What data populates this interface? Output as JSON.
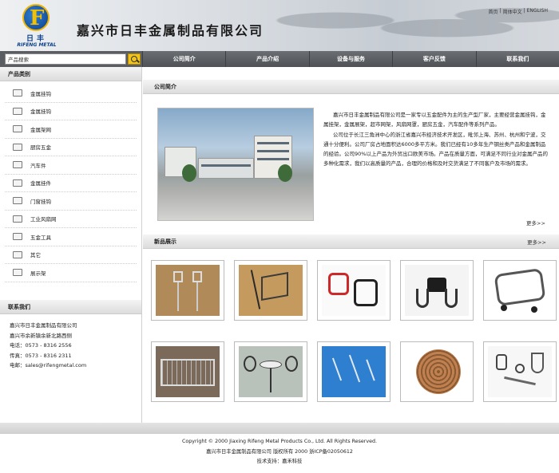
{
  "header": {
    "company_name": "嘉兴市日丰金属制品有限公司",
    "logo_cn": "日丰",
    "logo_en": "RIFENG METAL",
    "logo_letter": "F",
    "top_links": [
      "首页",
      "|",
      "简体中文",
      "|",
      "ENGLISH"
    ]
  },
  "search": {
    "value": "产品搜索"
  },
  "nav": [
    "公司简介",
    "产品介绍",
    "设备与服务",
    "客户反馈",
    "联系我们"
  ],
  "sidebar": {
    "category_title": "产品类别",
    "categories": [
      "金属挂钩",
      "金属挂钩",
      "金属架网",
      "厨房五金",
      "汽车件",
      "金属挂件",
      "门窗挂钩",
      "工业风扇网",
      "五金工具",
      "其它",
      "展示架"
    ],
    "contact_title": "联系我们",
    "contact_lines": [
      "嘉兴市日丰金属制品有限公司",
      "嘉兴市余新镇余新北路西侧",
      "电话：0573 - 8316 2556",
      "传真：0573 - 8316 2311",
      "电邮：sales@rifengmetal.com"
    ]
  },
  "about": {
    "title": "公司简介",
    "paragraphs": [
      "嘉兴市日丰金属制品有限公司是一家专以五金配件为主的生产型厂家，主要经营金属挂钩，金属挂架，金属展架，超市网架，风扇网罩，厨房五金，汽车配件等系列产品。",
      "公司位于长江三角洲中心的浙江省嘉兴市经济技术开发区，毗邻上海、苏州、杭州和宁波，交通十分便利。公司厂房占地面积达6000多平方米。我们已经有10多年生产钢丝类产品和金属制品的经验。公司90%以上产品为外贸出口欧美市场。产品在质量方面，可满足不同行业对金属产品的多种化需求，我们以高质量的产品，合理的价格和及时交货满足了不同客户及市场的需求。"
    ],
    "more": "更多>>"
  },
  "products_section": {
    "title": "新品展示",
    "more": "更多>>"
  },
  "products": [
    {
      "icon": "hook-pair-icon"
    },
    {
      "icon": "wire-rack-icon"
    },
    {
      "icon": "red-black-hooks-icon"
    },
    {
      "icon": "bracket-hook-icon"
    },
    {
      "icon": "wire-cart-icon"
    },
    {
      "icon": "wire-basket-icon"
    },
    {
      "icon": "bistro-chairs-icon"
    },
    {
      "icon": "pegboard-hooks-icon"
    },
    {
      "icon": "fan-guard-icon"
    },
    {
      "icon": "hardware-parts-icon"
    }
  ],
  "footer": {
    "copyright": "Copyright © 2000 Jiaxing Rifeng Metal Products Co., Ltd. All Rights Reserved.",
    "cn_line": "嘉兴市日丰金属制品有限公司 版权所有 2000 浙ICP备02050612",
    "support": "技术支持：嘉禾科技"
  },
  "colors": {
    "nav_bg": "#5a5d61",
    "accent": "#f2c31a",
    "logo_blue": "#0d3f8a"
  }
}
